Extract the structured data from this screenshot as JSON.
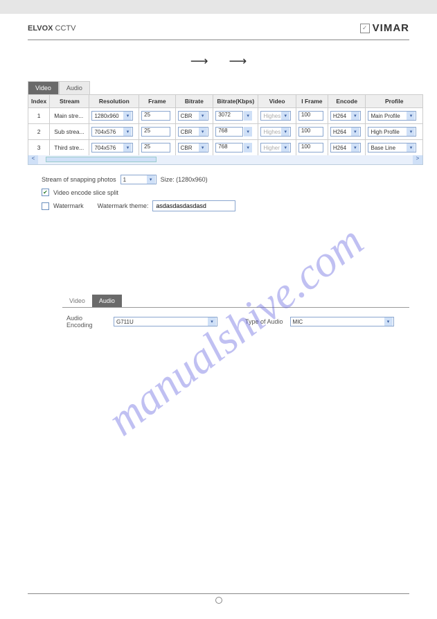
{
  "header": {
    "brand_prefix": "ELVOX",
    "brand_suffix": " CCTV",
    "logo_glyph": "✓",
    "brand_right": "VIMAR"
  },
  "arrows": {
    "a1": "⟶",
    "a2": "⟶"
  },
  "video_panel": {
    "tabs": {
      "video": "Video",
      "audio": "Audio"
    },
    "columns": [
      "Index",
      "Stream",
      "Resolution",
      "Frame",
      "Bitrate",
      "Bitrate(Kbps)",
      "Video",
      "I Frame",
      "Encode",
      "Profile"
    ],
    "rows": [
      {
        "index": "1",
        "stream": "Main stre...",
        "res": "1280x960",
        "frame": "25",
        "bitrate": "CBR",
        "bk": "3072",
        "video": "Highes",
        "iframe": "100",
        "encode": "H264",
        "profile": "Main Profile"
      },
      {
        "index": "2",
        "stream": "Sub strea...",
        "res": "704x576",
        "frame": "25",
        "bitrate": "CBR",
        "bk": "768",
        "video": "Highes",
        "iframe": "100",
        "encode": "H264",
        "profile": "High Profile"
      },
      {
        "index": "3",
        "stream": "Third stre...",
        "res": "704x576",
        "frame": "25",
        "bitrate": "CBR",
        "bk": "768",
        "video": "Higher",
        "iframe": "100",
        "encode": "H264",
        "profile": "Base Line"
      }
    ],
    "snap_label": "Stream of snapping photos",
    "snap_value": "1",
    "snap_size": "Size: (1280x960)",
    "slice_label": "Video encode slice split",
    "watermark_label": "Watermark",
    "watermark_theme_label": "Watermark theme:",
    "watermark_theme_value": "asdasdasdasdasd"
  },
  "audio_panel": {
    "tabs": {
      "video": "Video",
      "audio": "Audio"
    },
    "enc_label": "Audio Encoding",
    "enc_value": "G711U",
    "type_label": "Type of Audio",
    "type_value": "MIC"
  },
  "wm": "manualshive.com"
}
